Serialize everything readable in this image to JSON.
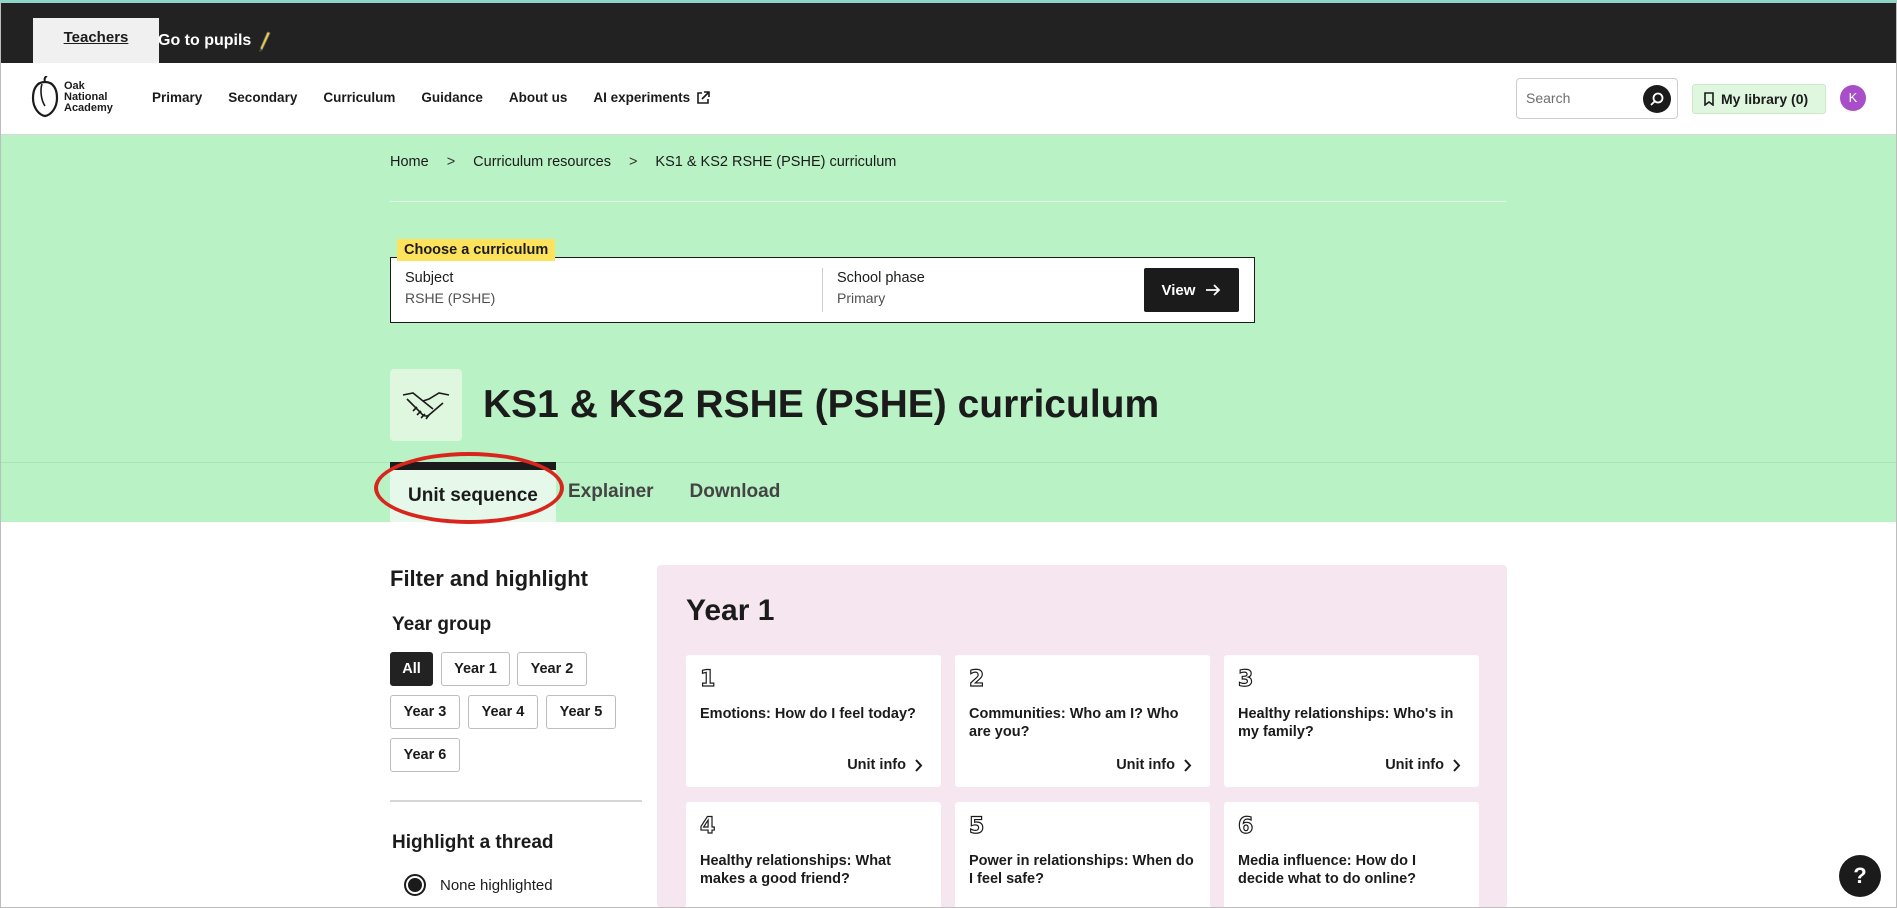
{
  "topbar": {
    "teachers_tab": "Teachers",
    "go_to_pupils": "Go to pupils"
  },
  "header": {
    "logo_lines": [
      "Oak",
      "National",
      "Academy"
    ],
    "nav": [
      "Primary",
      "Secondary",
      "Curriculum",
      "Guidance",
      "About us",
      "AI experiments"
    ],
    "search_placeholder": "Search",
    "my_library": "My library (0)",
    "avatar_initial": "K"
  },
  "breadcrumb": [
    "Home",
    "Curriculum resources",
    "KS1 & KS2 RSHE (PSHE) curriculum"
  ],
  "chooser": {
    "tag": "Choose a curriculum",
    "subject_label": "Subject",
    "subject_value": "RSHE (PSHE)",
    "phase_label": "School phase",
    "phase_value": "Primary",
    "view_button": "View"
  },
  "page_title": "KS1 & KS2 RSHE (PSHE) curriculum",
  "tabs": [
    "Unit sequence",
    "Explainer",
    "Download"
  ],
  "filter": {
    "title": "Filter and highlight",
    "year_group_title": "Year group",
    "chips": [
      "All",
      "Year 1",
      "Year 2",
      "Year 3",
      "Year 4",
      "Year 5",
      "Year 6"
    ],
    "thread_title": "Highlight a thread",
    "none_highlighted": "None highlighted"
  },
  "year_panel": {
    "title": "Year 1",
    "units": [
      {
        "num": "1",
        "title": "Emotions: How do I feel today?",
        "link": "Unit info"
      },
      {
        "num": "2",
        "title": "Communities: Who am I? Who are you?",
        "link": "Unit info"
      },
      {
        "num": "3",
        "title": "Healthy relationships: Who's in my family?",
        "link": "Unit info"
      },
      {
        "num": "4",
        "title": "Healthy relationships: What makes a good friend?",
        "link": "Unit info"
      },
      {
        "num": "5",
        "title": "Power in relationships: When do I feel safe?",
        "link": "Unit info"
      },
      {
        "num": "6",
        "title": "Media influence: How do I decide what to do online?",
        "link": "Unit info"
      }
    ]
  },
  "help_button": "?",
  "colors": {
    "hero_bg": "#b9f2c4",
    "panel_bg": "#f5e6ef",
    "tag_yellow": "#fde25b",
    "annotation_red": "#d8261e",
    "avatar": "#a94ec9"
  }
}
